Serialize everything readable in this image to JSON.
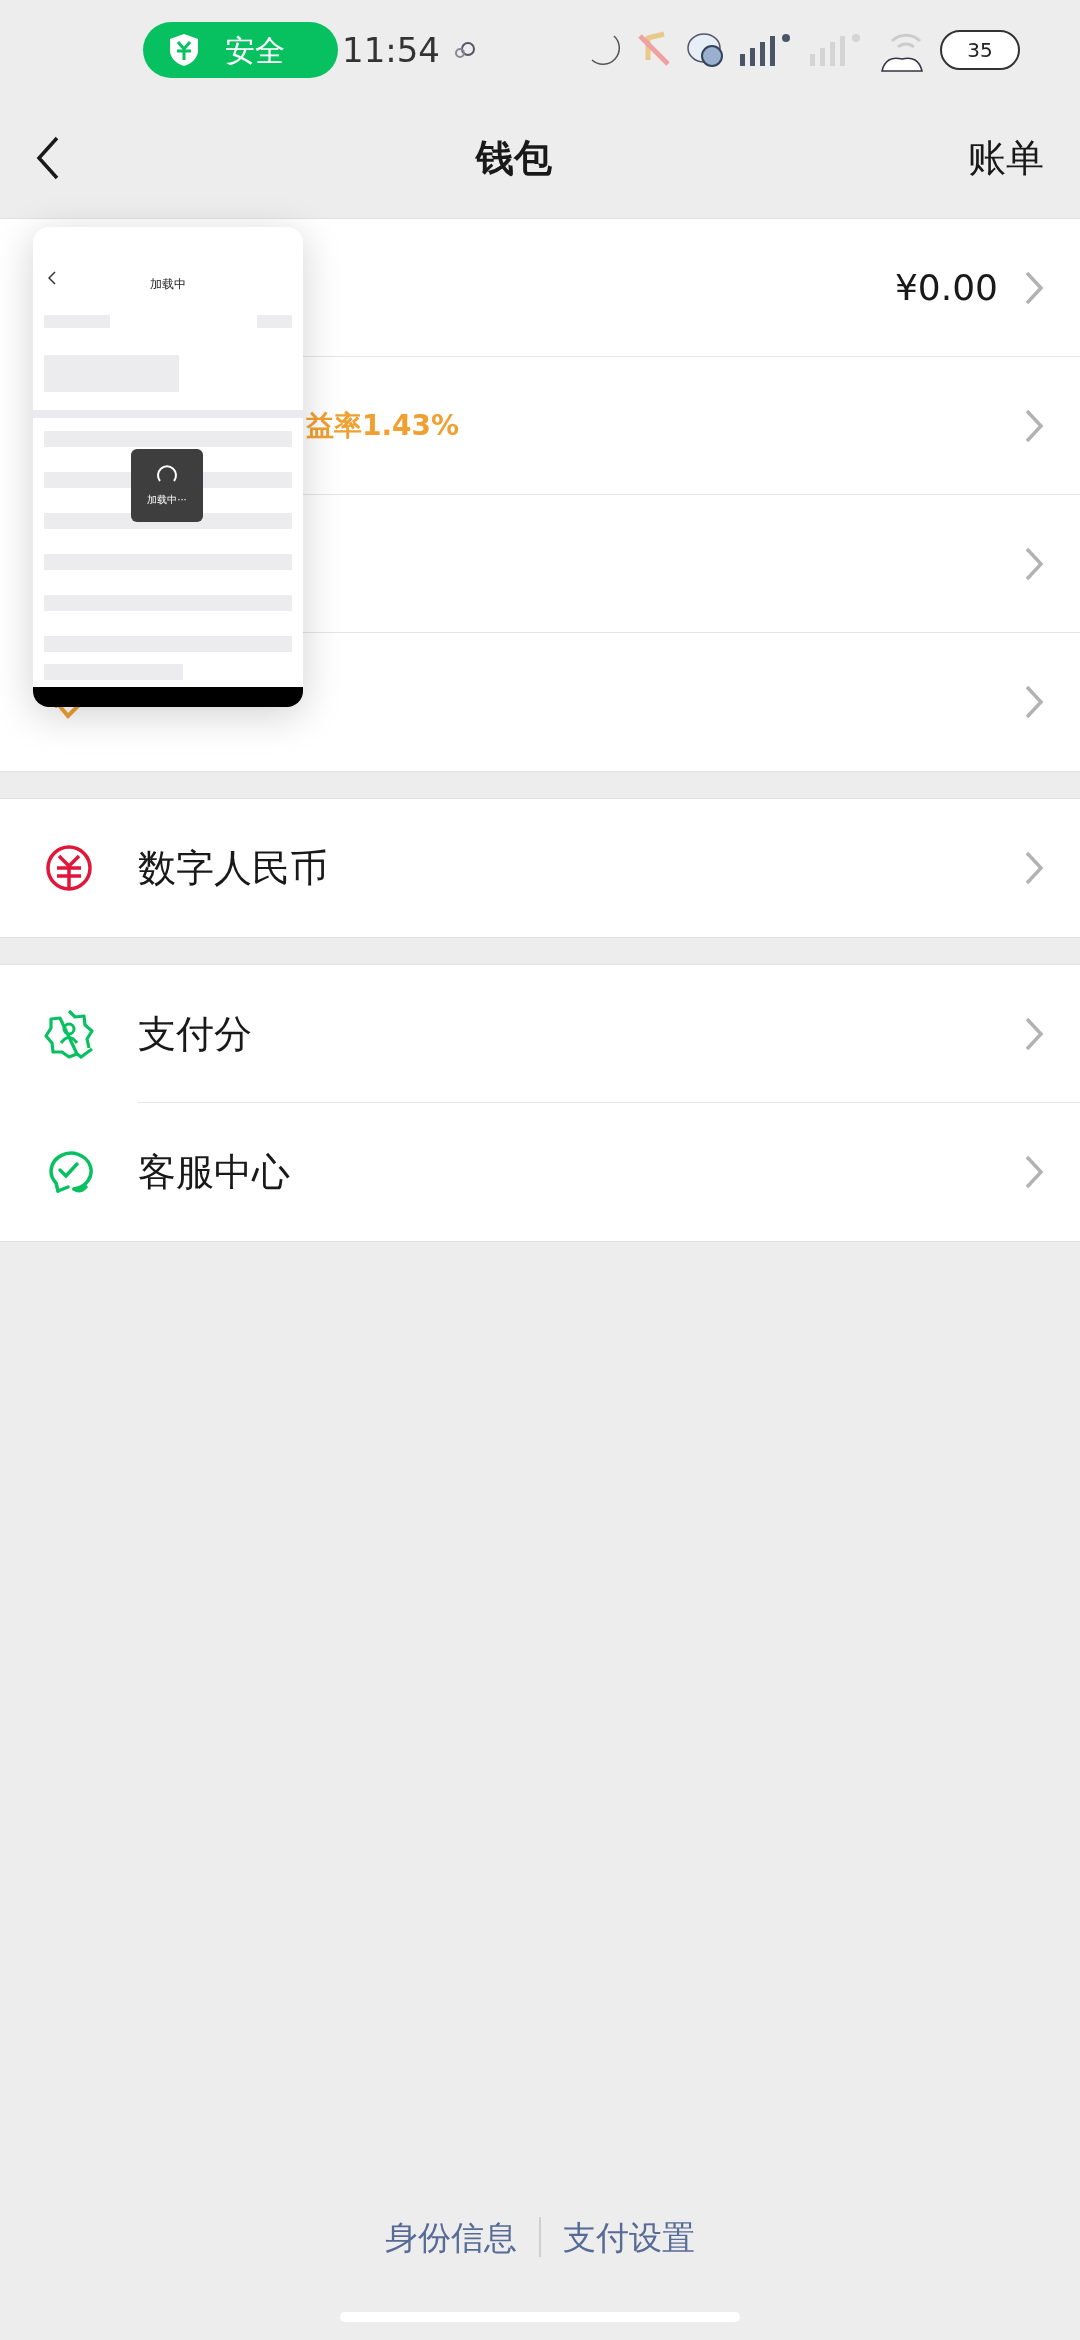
{
  "status_bar": {
    "security_badge": "安全",
    "time": "11:54",
    "battery": "35"
  },
  "nav": {
    "title": "钱包",
    "action": "账单"
  },
  "groups": [
    {
      "rows": [
        {
          "kind": "value",
          "value": "¥0.00"
        },
        {
          "kind": "note",
          "note": "益率1.43%"
        },
        {
          "kind": "plain"
        },
        {
          "kind": "plain"
        }
      ]
    },
    {
      "rows": [
        {
          "kind": "label",
          "label": "数字人民币"
        }
      ]
    },
    {
      "rows": [
        {
          "kind": "label",
          "label": "支付分"
        },
        {
          "kind": "label",
          "label": "客服中心"
        }
      ]
    }
  ],
  "loading_preview": {
    "title": "加载中",
    "toast": "加载中···"
  },
  "footer_links": [
    "身份信息",
    "支付设置"
  ]
}
